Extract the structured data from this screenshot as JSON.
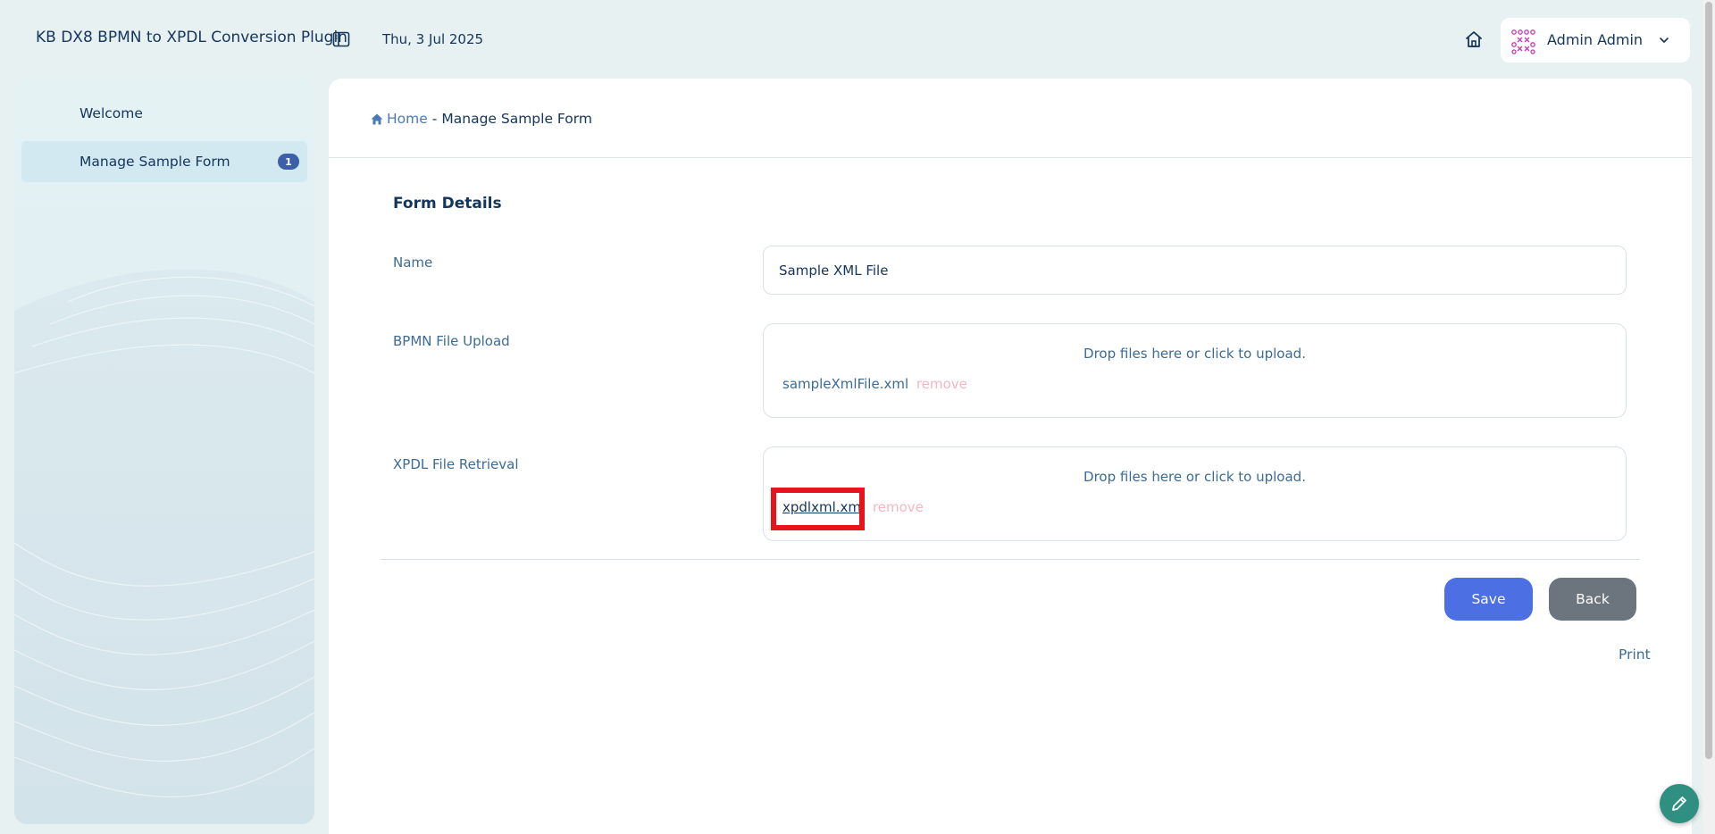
{
  "header": {
    "app_title": "KB DX8 BPMN to XPDL Conversion Plugin",
    "date": "Thu, 3 Jul 2025",
    "user_name": "Admin Admin",
    "icons": [
      "sidebar-toggle-icon",
      "home-icon",
      "avatar-pattern-icon",
      "chevron-down-icon"
    ]
  },
  "sidebar": {
    "items": [
      {
        "label": "Welcome",
        "active": false
      },
      {
        "label": "Manage Sample Form",
        "active": true,
        "badge": "1"
      }
    ]
  },
  "breadcrumb": {
    "home": "Home",
    "separator": "-",
    "current": "Manage Sample Form"
  },
  "form": {
    "section_title": "Form Details",
    "name": {
      "label": "Name",
      "value": "Sample XML File"
    },
    "bpmn": {
      "label": "BPMN File Upload",
      "drop_message": "Drop files here or click to upload.",
      "file_name": "sampleXmlFile.xml",
      "remove_label": "remove"
    },
    "xpdl": {
      "label": "XPDL File Retrieval",
      "drop_message": "Drop files here or click to upload.",
      "file_name": "xpdlxml.xml",
      "remove_label": "remove",
      "highlight_color": "#e8131b"
    }
  },
  "actions": {
    "save_label": "Save",
    "back_label": "Back",
    "print_label": "Print"
  },
  "colors": {
    "primary": "#4c6fe3",
    "secondary": "#6c757d",
    "badge": "#3d5fa8",
    "fab": "#2f8f80"
  }
}
